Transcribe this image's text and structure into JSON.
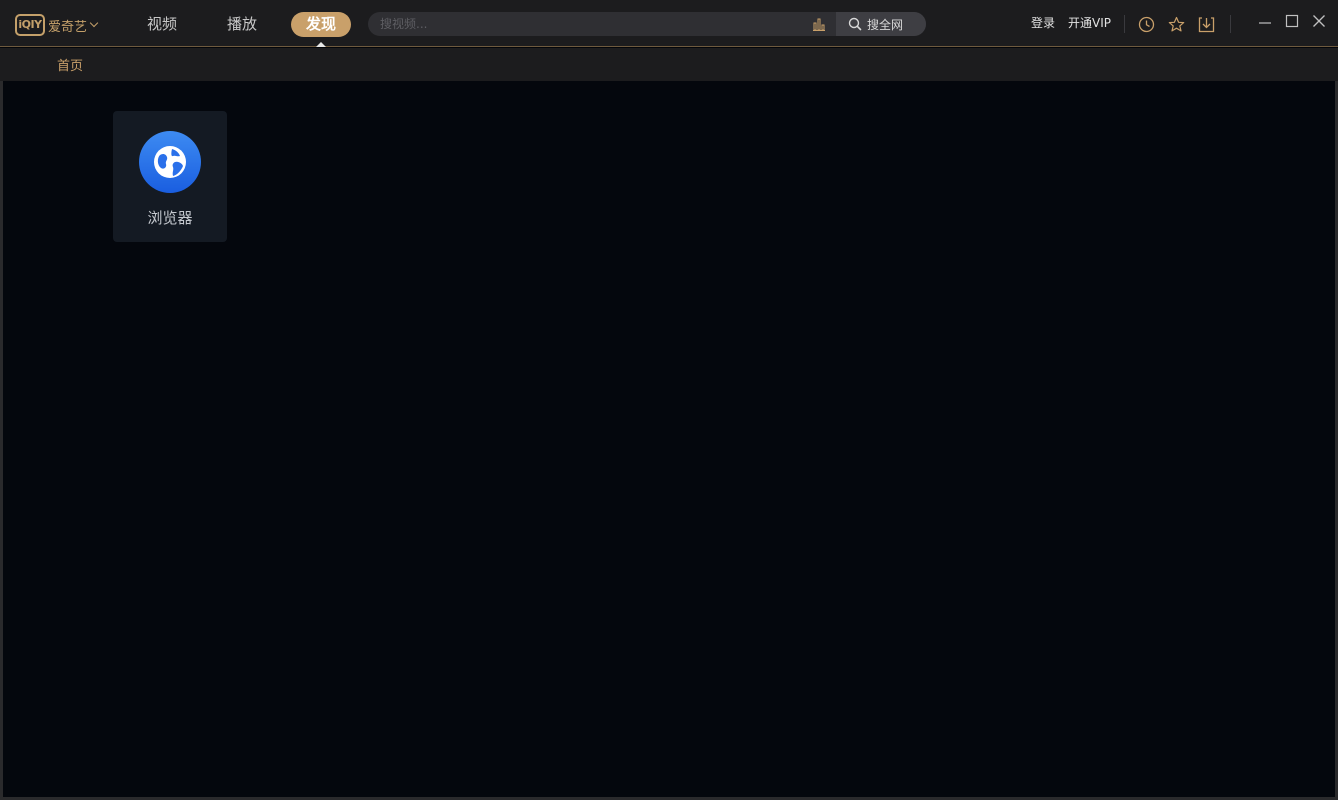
{
  "app": {
    "logo_mark": "iQIY",
    "logo_text": "爱奇艺",
    "brand_color": "#c9a06a"
  },
  "nav": {
    "tabs": [
      {
        "label": "视频"
      },
      {
        "label": "播放"
      },
      {
        "label": "发现",
        "active": true
      }
    ]
  },
  "search": {
    "placeholder": "搜视频...",
    "hot_icon": "chart-bars-icon",
    "button_label": "搜全网"
  },
  "header_right": {
    "login_label": "登录",
    "vip_label": "开通VIP",
    "icons": [
      "history-clock-icon",
      "favorite-star-icon",
      "download-icon"
    ]
  },
  "window_controls": [
    "minimize-icon",
    "maximize-icon",
    "close-icon"
  ],
  "subnav": {
    "items": [
      {
        "label": "首页"
      }
    ]
  },
  "content": {
    "apps": [
      {
        "label": "浏览器",
        "icon": "globe-icon"
      }
    ]
  }
}
